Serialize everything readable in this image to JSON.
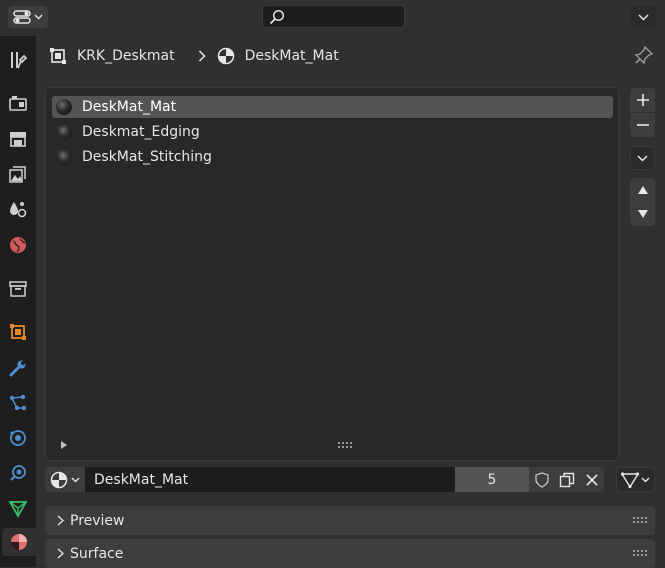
{
  "header": {
    "object_name": "KRK_Deskmat",
    "material_name": "DeskMat_Mat"
  },
  "material_slots": [
    {
      "name": "DeskMat_Mat",
      "selected": true
    },
    {
      "name": "Deskmat_Edging",
      "selected": false
    },
    {
      "name": "DeskMat_Stitching",
      "selected": false
    }
  ],
  "material_bar": {
    "name": "DeskMat_Mat",
    "users": "5"
  },
  "panels": [
    {
      "title": "Preview"
    },
    {
      "title": "Surface"
    }
  ],
  "sidebar_tabs": [
    "tool-tab",
    "render-tab",
    "output-tab",
    "view-layer-tab",
    "scene-tab",
    "world-tab",
    "collection-tab",
    "object-tab",
    "modifiers-tab",
    "particles-tab",
    "physics-tab",
    "constraints-tab",
    "data-tab",
    "material-tab"
  ],
  "colors": {
    "accent_orange": "#e8872a",
    "accent_blue": "#4f8fd1",
    "accent_green": "#3ec46b",
    "material_tab": "#e07070",
    "selected_row": "#545454"
  }
}
